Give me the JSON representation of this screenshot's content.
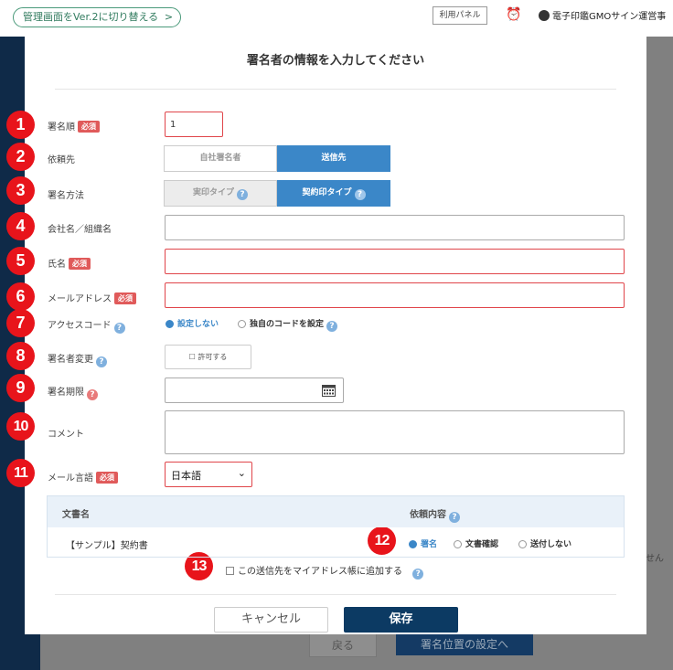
{
  "background": {
    "v2_switch_label": "管理画面をVer.2に切り替える",
    "v2_switch_chevron": ">",
    "panel_button": "利用パネル",
    "user_name": "電子印鑑GMOサイン運営事",
    "back_button": "戻る",
    "position_button": "署名位置の設定へ",
    "side_text": "せん"
  },
  "modal": {
    "title": "署名者の情報を入力してください",
    "markers": [
      "1",
      "2",
      "3",
      "4",
      "5",
      "6",
      "7",
      "8",
      "9",
      "10",
      "11",
      "12",
      "13"
    ],
    "required_badge": "必須",
    "fields": {
      "order": {
        "label": "署名順",
        "value": "1"
      },
      "request_to": {
        "label": "依頼先",
        "options": [
          "自社署名者",
          "送信先"
        ],
        "selected": "送信先"
      },
      "sign_method": {
        "label": "署名方法",
        "options": [
          "実印タイプ",
          "契約印タイプ"
        ],
        "selected": "契約印タイプ"
      },
      "company": {
        "label": "会社名／組織名",
        "value": ""
      },
      "name": {
        "label": "氏名",
        "value": ""
      },
      "email": {
        "label": "メールアドレス",
        "value": ""
      },
      "access_code": {
        "label": "アクセスコード",
        "options": [
          "設定しない",
          "独自のコードを設定"
        ],
        "selected": "設定しない"
      },
      "signer_change": {
        "label": "署名者変更",
        "button": "許可する"
      },
      "deadline": {
        "label": "署名期限",
        "value": ""
      },
      "comment": {
        "label": "コメント",
        "value": ""
      },
      "mail_language": {
        "label": "メール言語",
        "value": "日本語"
      }
    },
    "documents": {
      "col_name": "文書名",
      "col_request": "依頼内容",
      "rows": [
        {
          "name": "【サンプル】契約書",
          "options": [
            "署名",
            "文書確認",
            "送付しない"
          ],
          "selected": "署名"
        }
      ]
    },
    "address_book_checkbox": "この送信先をマイアドレス帳に追加する",
    "cancel_label": "キャンセル",
    "save_label": "保存"
  },
  "help_glyph": "?",
  "calendar_icon": "calendar-icon",
  "colors": {
    "accent": "#3b87c8",
    "save": "#0c3a63",
    "marker": "#e8141b",
    "required": "#e05a5a"
  }
}
